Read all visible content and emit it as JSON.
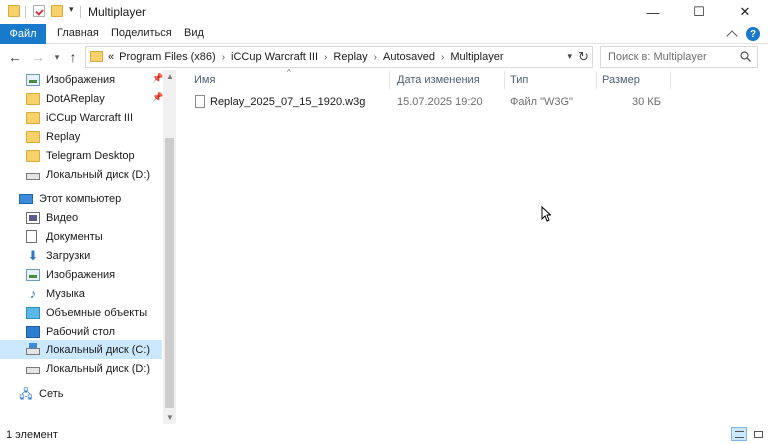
{
  "window": {
    "title": "Multiplayer",
    "controls": {
      "minimize": "—",
      "maximize": "☐",
      "close": "✕"
    }
  },
  "ribbon": {
    "file_tab": "Файл",
    "tabs": [
      "Главная",
      "Поделиться",
      "Вид"
    ]
  },
  "address": {
    "prefix": "«",
    "crumbs": [
      "Program Files (x86)",
      "iCCup Warcraft III",
      "Replay",
      "Autosaved",
      "Multiplayer"
    ]
  },
  "search": {
    "placeholder": "Поиск в: Multiplayer"
  },
  "nav_pane": {
    "quick_access": [
      {
        "label": "Изображения",
        "icon": "pictures-icon",
        "pinned": true
      },
      {
        "label": "DotAReplay",
        "icon": "folder-icon",
        "pinned": true
      },
      {
        "label": "iCCup Warcraft III",
        "icon": "folder-icon",
        "pinned": false
      },
      {
        "label": "Replay",
        "icon": "folder-icon",
        "pinned": false
      },
      {
        "label": "Telegram Desktop",
        "icon": "folder-icon",
        "pinned": false
      },
      {
        "label": "Локальный диск (D:)",
        "icon": "drive-icon",
        "pinned": false
      }
    ],
    "this_pc": {
      "label": "Этот компьютер",
      "items": [
        {
          "label": "Видео",
          "icon": "videos-icon"
        },
        {
          "label": "Документы",
          "icon": "documents-icon"
        },
        {
          "label": "Загрузки",
          "icon": "downloads-icon"
        },
        {
          "label": "Изображения",
          "icon": "pictures-icon"
        },
        {
          "label": "Музыка",
          "icon": "music-icon"
        },
        {
          "label": "Объемные объекты",
          "icon": "3d-objects-icon"
        },
        {
          "label": "Рабочий стол",
          "icon": "desktop-icon"
        },
        {
          "label": "Локальный диск (C:)",
          "icon": "system-drive-icon",
          "selected": true
        },
        {
          "label": "Локальный диск (D:)",
          "icon": "drive-icon"
        }
      ]
    },
    "network": {
      "label": "Сеть",
      "icon": "network-icon"
    }
  },
  "columns": {
    "name": "Имя",
    "modified": "Дата изменения",
    "type": "Тип",
    "size": "Размер"
  },
  "files": [
    {
      "name": "Replay_2025_07_15_1920.w3g",
      "modified": "15.07.2025 19:20",
      "type": "Файл \"W3G\"",
      "size": "30 КБ"
    }
  ],
  "status": {
    "item_count": "1 элемент"
  },
  "colors": {
    "accent": "#1979ca",
    "selection": "#cce8ff",
    "header_text": "#4c607a"
  }
}
